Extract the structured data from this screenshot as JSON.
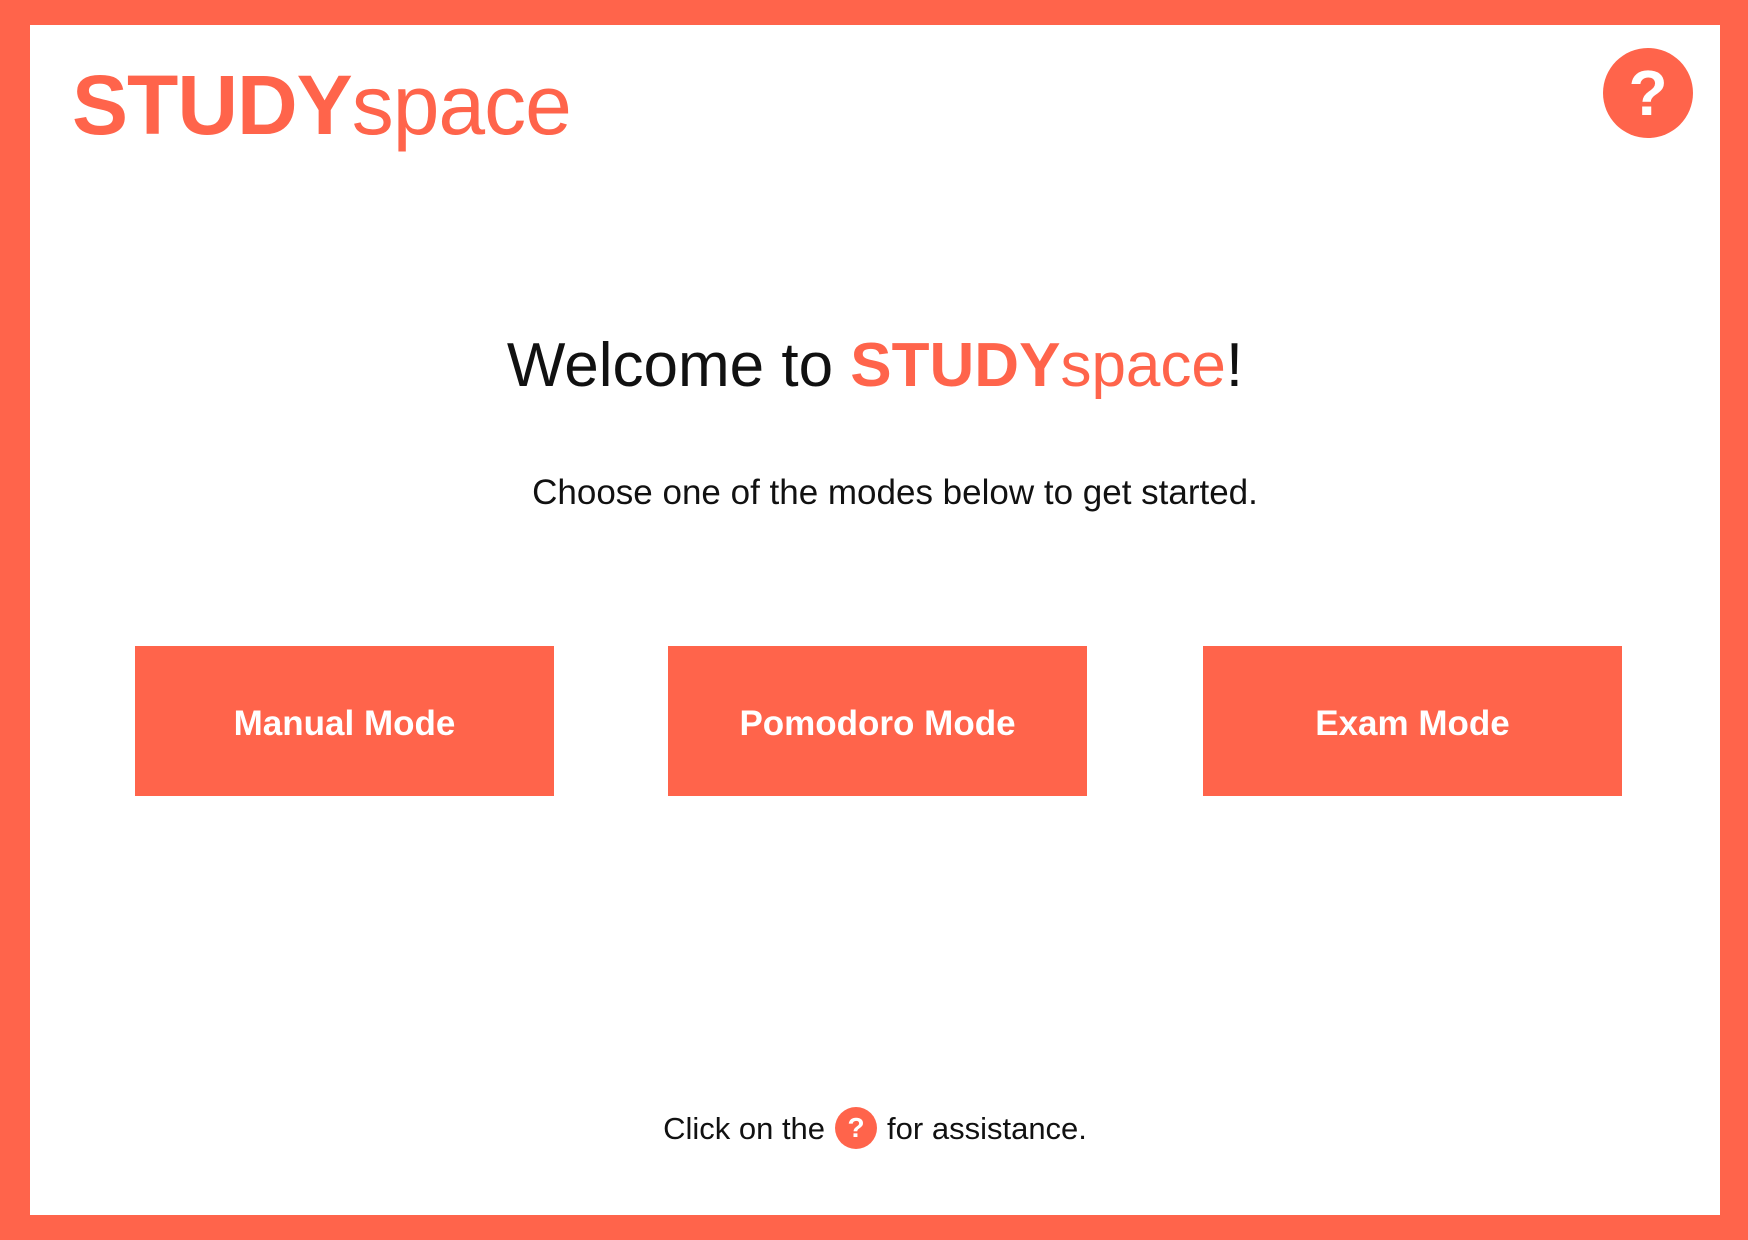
{
  "brand": {
    "strong": "STUDY",
    "light": "space"
  },
  "help_button": {
    "label": "?",
    "icon": "help-icon"
  },
  "welcome": {
    "prefix": "Welcome to ",
    "brand_strong": "STUDY",
    "brand_light": "space",
    "suffix": "!"
  },
  "subtitle": "Choose one of the modes below to get started.",
  "modes": [
    {
      "label": "Manual Mode"
    },
    {
      "label": "Pomodoro Mode"
    },
    {
      "label": "Exam Mode"
    }
  ],
  "footer": {
    "prefix": "Click on the",
    "icon_label": "?",
    "suffix": "for assistance."
  },
  "colors": {
    "accent": "#ff644b",
    "background": "#ffffff",
    "text": "#111111"
  }
}
